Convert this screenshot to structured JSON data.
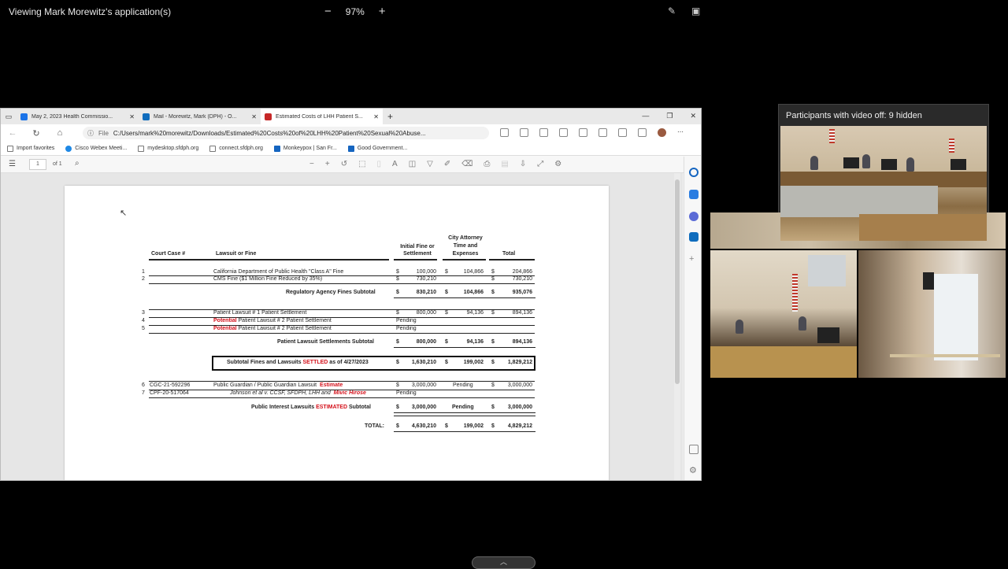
{
  "share_bar": {
    "title": "Viewing Mark Morewitz's application(s)",
    "zoom_minus": "−",
    "zoom_level": "97%",
    "zoom_plus": "+"
  },
  "browser": {
    "tabs": [
      {
        "label": "May 2, 2023 Health Commissio...",
        "color": "#1a73e8"
      },
      {
        "label": "Mail - Morewitz, Mark (DPH) - O...",
        "color": "#0f6cbd"
      },
      {
        "label": "Estimated Costs of LHH Patient S...",
        "color": "#c62828"
      }
    ],
    "new_tab": "+",
    "url_label": "File",
    "url": "C:/Users/mark%20morewitz/Downloads/Estimated%20Costs%20of%20LHH%20Patient%20Sexual%20Abuse...",
    "bookmarks": [
      {
        "label": "Import favorites",
        "color": "#777777"
      },
      {
        "label": "Cisco Webex Meeti...",
        "color": "#1e88e5"
      },
      {
        "label": "mydesktop.sfdph.org",
        "color": "#777777"
      },
      {
        "label": "connect.sfdph.org",
        "color": "#777777"
      },
      {
        "label": "Monkeypox | San Fr...",
        "color": "#1565c0"
      },
      {
        "label": "Good Government...",
        "color": "#1565c0"
      }
    ],
    "pdf": {
      "page_num": "1",
      "of_pages": "of 1"
    }
  },
  "doc": {
    "headers": {
      "court_case": "Court Case #",
      "lawsuit": "Lawsuit or Fine",
      "initial": "Initial Fine or Settlement",
      "city": "City Attorney Time and Expenses",
      "total": "Total"
    },
    "rows": [
      {
        "n": "1",
        "case": "",
        "desc": "California Department of Public Health \"Class A\" Fine",
        "s1": "$",
        "initial": "100,000",
        "s2": "$",
        "city": "104,866",
        "s3": "$",
        "total": "204,866"
      },
      {
        "n": "2",
        "case": "",
        "desc": "CMS Fine ($1 Million Fine Reduced by 35%)",
        "s1": "$",
        "initial": "730,210",
        "s2": "",
        "city": "",
        "s3": "$",
        "total": "730,210"
      }
    ],
    "reg_subtotal": {
      "label": "Regulatory Agency Fines Subtotal",
      "s1": "$",
      "initial": "830,210",
      "s2": "$",
      "city": "104,866",
      "s3": "$",
      "total": "935,076"
    },
    "patient_rows": [
      {
        "n": "3",
        "pre": "",
        "desc": "Patient Lawsuit # 1 Patient Settlement",
        "s1": "$",
        "initial": "800,000",
        "s2": "$",
        "city": "94,136",
        "s3": "$",
        "total": "894,136"
      },
      {
        "n": "4",
        "pre": "Potential",
        "desc": " Patient Lawsuit # 2 Patient Settlement",
        "s1": "",
        "initial": "Pending",
        "s2": "",
        "city": "",
        "s3": "",
        "total": ""
      },
      {
        "n": "5",
        "pre": "Potential",
        "desc": " Patient Lawsuit # 2 Patient Settlement",
        "s1": "",
        "initial": "Pending",
        "s2": "",
        "city": "",
        "s3": "",
        "total": ""
      }
    ],
    "patient_subtotal": {
      "label": "Patient Lawsuit Settlements Subtotal",
      "s1": "$",
      "initial": "800,000",
      "s2": "$",
      "city": "94,136",
      "s3": "$",
      "total": "894,136"
    },
    "settled": {
      "pre": "Subtotal Fines and Lawsuits ",
      "red": "SETTLED",
      "post": " as of 4/27/2023",
      "s1": "$",
      "initial": "1,630,210",
      "s2": "$",
      "city": "199,002",
      "s3": "$",
      "total": "1,829,212"
    },
    "public_rows": [
      {
        "n": "6",
        "case": "CGC-21-592296",
        "desc": "Public Guardian / Public Guardian Lawsuit",
        "red": "Estimate",
        "s1": "$",
        "initial": "3,000,000",
        "city": "Pending",
        "s3": "$",
        "total": "3,000,000"
      },
      {
        "n": "7",
        "case": "CPF-20-517064",
        "desc": "Johnson et al v. CCSF, SFDPH, LHH and",
        "red": "Mivic Hirose",
        "s1": "",
        "initial": "Pending",
        "city": "",
        "s3": "",
        "total": ""
      }
    ],
    "public_subtotal": {
      "pre": "Public Interest Lawsuits ",
      "red": "ESTIMATED",
      "post": " Subtotal",
      "s1": "$",
      "initial": "3,000,000",
      "city": "Pending",
      "s3": "$",
      "total": "3,000,000"
    },
    "grand_total": {
      "label": "TOTAL:",
      "s1": "$",
      "initial": "4,630,210",
      "s2": "$",
      "city": "199,002",
      "s3": "$",
      "total": "4,829,212"
    }
  },
  "participants": {
    "title": "Participants with video off: 9 hidden"
  }
}
